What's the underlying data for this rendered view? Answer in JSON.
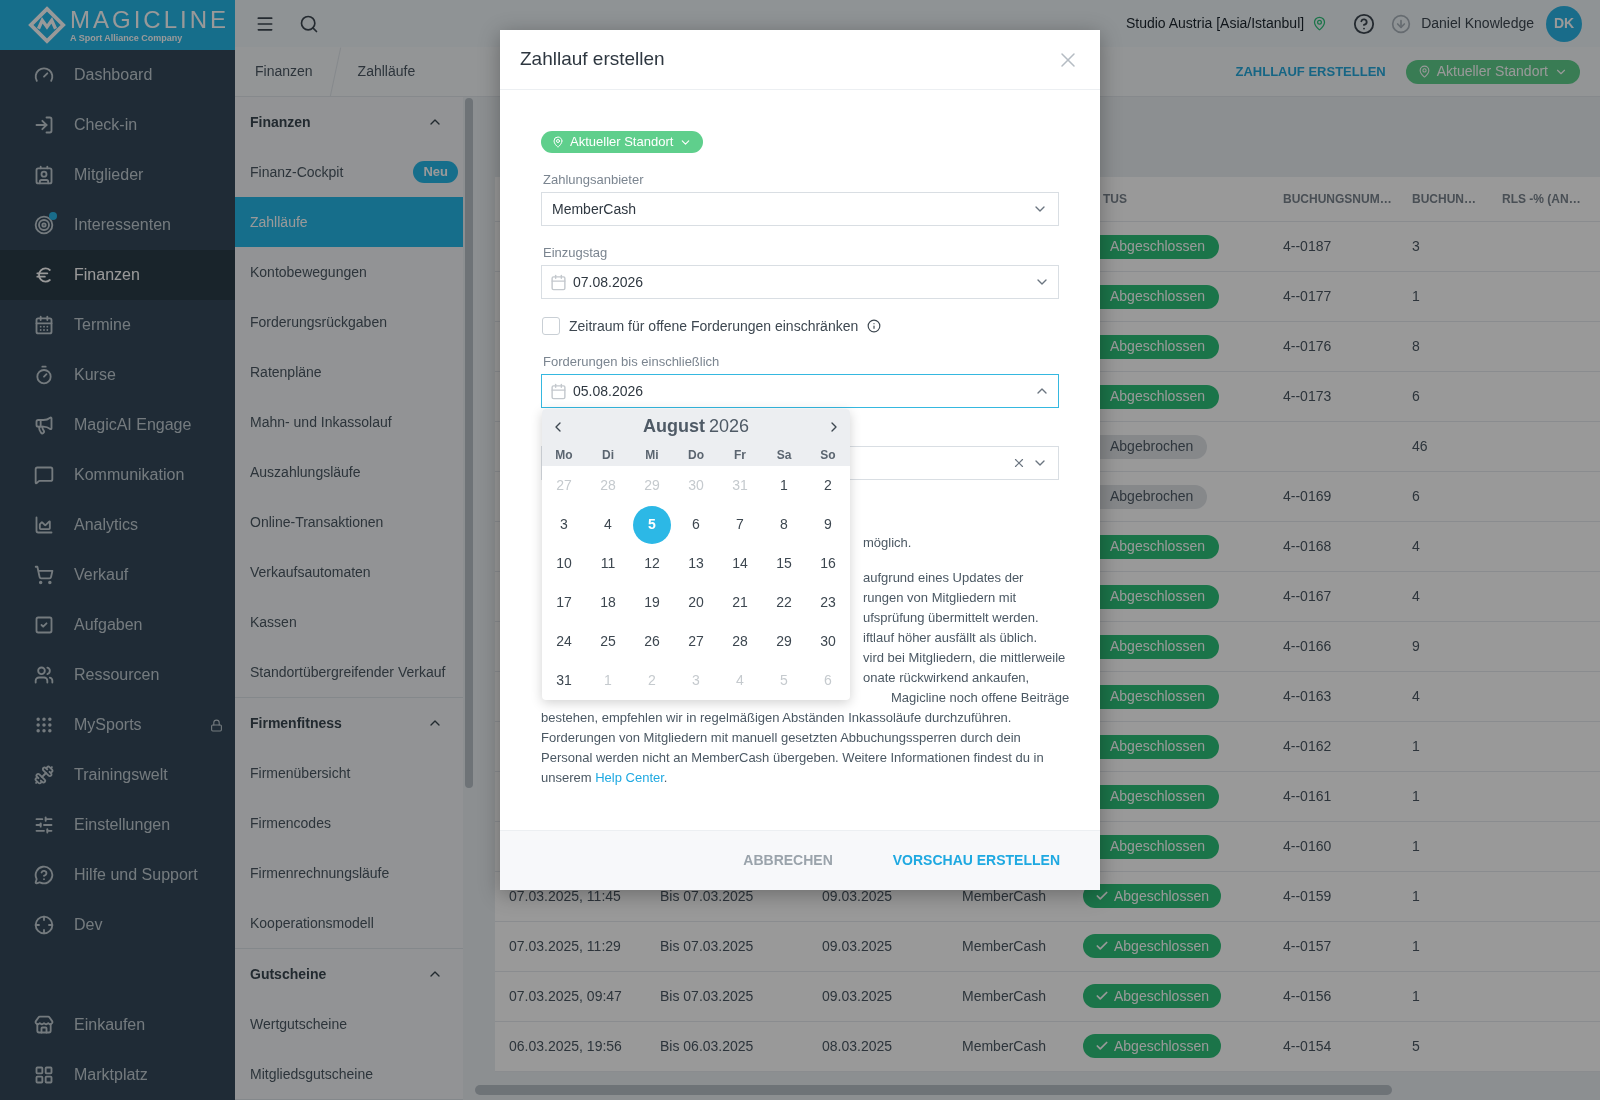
{
  "logo": {
    "name": "MAGICLINE",
    "tagline": "A Sport Alliance Company"
  },
  "nav": [
    {
      "label": "Dashboard",
      "selected": false,
      "dot": false,
      "locked": false
    },
    {
      "label": "Check-in",
      "selected": false,
      "dot": false,
      "locked": false
    },
    {
      "label": "Mitglieder",
      "selected": false,
      "dot": false,
      "locked": false
    },
    {
      "label": "Interessenten",
      "selected": false,
      "dot": true,
      "locked": false
    },
    {
      "label": "Finanzen",
      "selected": true,
      "dot": false,
      "locked": false
    },
    {
      "label": "Termine",
      "selected": false,
      "dot": false,
      "locked": false
    },
    {
      "label": "Kurse",
      "selected": false,
      "dot": false,
      "locked": false
    },
    {
      "label": "MagicAI Engage",
      "selected": false,
      "dot": false,
      "locked": false
    },
    {
      "label": "Kommunikation",
      "selected": false,
      "dot": false,
      "locked": false
    },
    {
      "label": "Analytics",
      "selected": false,
      "dot": false,
      "locked": false
    },
    {
      "label": "Verkauf",
      "selected": false,
      "dot": false,
      "locked": false
    },
    {
      "label": "Aufgaben",
      "selected": false,
      "dot": false,
      "locked": false
    },
    {
      "label": "Ressourcen",
      "selected": false,
      "dot": false,
      "locked": false
    },
    {
      "label": "MySports",
      "selected": false,
      "dot": false,
      "locked": true
    },
    {
      "label": "Trainingswelt",
      "selected": false,
      "dot": false,
      "locked": false
    },
    {
      "label": "Einstellungen",
      "selected": false,
      "dot": false,
      "locked": false
    },
    {
      "label": "Hilfe und Support",
      "selected": false,
      "dot": false,
      "locked": false
    },
    {
      "label": "Dev",
      "selected": false,
      "dot": false,
      "locked": false
    }
  ],
  "nav_bottom": [
    {
      "label": "Einkaufen",
      "selected": false
    },
    {
      "label": "Marktplatz",
      "selected": false
    }
  ],
  "top_bar": {
    "location": "Studio Austria [Asia/Istanbul]",
    "user": "Daniel Knowledge",
    "avatar": "DK"
  },
  "breadcrumb": [
    "Finanzen",
    "Zahlläufe"
  ],
  "header_actions": {
    "link": "ZAHLLAUF ERSTELLEN",
    "location_pill": "Aktueller Standort"
  },
  "subnav": [
    {
      "title": "Finanzen",
      "expanded": true,
      "items": [
        {
          "label": "Finanz-Cockpit",
          "selected": false,
          "badge": "Neu"
        },
        {
          "label": "Zahlläufe",
          "selected": true
        },
        {
          "label": "Kontobewegungen",
          "selected": false
        },
        {
          "label": "Forderungsrückgaben",
          "selected": false
        },
        {
          "label": "Ratenpläne",
          "selected": false
        },
        {
          "label": "Mahn- und Inkassolauf",
          "selected": false
        },
        {
          "label": "Auszahlungsläufe",
          "selected": false
        },
        {
          "label": "Online-Transaktionen",
          "selected": false
        },
        {
          "label": "Verkaufsautomaten",
          "selected": false
        },
        {
          "label": "Kassen",
          "selected": false
        },
        {
          "label": "Standortübergreifender Verkauf",
          "selected": false
        }
      ]
    },
    {
      "title": "Firmenfitness",
      "expanded": true,
      "items": [
        {
          "label": "Firmenübersicht",
          "selected": false
        },
        {
          "label": "Firmencodes",
          "selected": false
        },
        {
          "label": "Firmenrechnungsläufe",
          "selected": false
        },
        {
          "label": "Kooperationsmodell",
          "selected": false
        }
      ]
    },
    {
      "title": "Gutscheine",
      "expanded": true,
      "items": [
        {
          "label": "Wertgutscheine",
          "selected": false
        },
        {
          "label": "Mitgliedsgutscheine",
          "selected": false
        }
      ]
    }
  ],
  "table": {
    "columns": [
      "TUS",
      "BUCHUNGSNUM…",
      "BUCHUN…",
      "RLS -% (AN…"
    ],
    "rows": [
      {
        "status": {
          "kind": "done",
          "label": "Abgeschlossen"
        },
        "column_6": "4--0187",
        "column_7": "3"
      },
      {
        "status": {
          "kind": "done",
          "label": "Abgeschlossen"
        },
        "column_6": "4--0177",
        "column_7": "1"
      },
      {
        "status": {
          "kind": "done",
          "label": "Abgeschlossen"
        },
        "column_6": "4--0176",
        "column_7": "8"
      },
      {
        "status": {
          "kind": "done",
          "label": "Abgeschlossen"
        },
        "column_6": "4--0173",
        "column_7": "6"
      },
      {
        "status": {
          "kind": "cancelled",
          "label": "Abgebrochen"
        },
        "column_7": "46"
      },
      {
        "status": {
          "kind": "cancelled",
          "label": "Abgebrochen"
        },
        "column_6": "4--0169",
        "column_7": "6"
      },
      {
        "status": {
          "kind": "done",
          "label": "Abgeschlossen"
        },
        "column_6": "4--0168",
        "column_7": "4"
      },
      {
        "status": {
          "kind": "done",
          "label": "Abgeschlossen"
        },
        "column_6": "4--0167",
        "column_7": "4"
      },
      {
        "status": {
          "kind": "done",
          "label": "Abgeschlossen"
        },
        "column_6": "4--0166",
        "column_7": "9"
      },
      {
        "status": {
          "kind": "done",
          "label": "Abgeschlossen"
        },
        "column_6": "4--0163",
        "column_7": "4"
      },
      {
        "status": {
          "kind": "done",
          "label": "Abgeschlossen"
        },
        "column_6": "4--0162",
        "column_7": "1"
      },
      {
        "status": {
          "kind": "done",
          "label": "Abgeschlossen"
        },
        "column_6": "4--0161",
        "column_7": "1"
      },
      {
        "status": {
          "kind": "done",
          "label": "Abgeschlossen"
        },
        "column_6": "4--0160",
        "column_7": "1"
      },
      {
        "column_1": "07.03.2025, 11:45",
        "column_2": "Bis 07.03.2025",
        "column_3": "09.03.2025",
        "column_4": "MemberCash",
        "status": {
          "kind": "done",
          "label": "Abgeschlossen"
        },
        "column_6": "4--0159",
        "column_7": "1"
      },
      {
        "column_1": "07.03.2025, 11:29",
        "column_2": "Bis 07.03.2025",
        "column_3": "09.03.2025",
        "column_4": "MemberCash",
        "status": {
          "kind": "done",
          "label": "Abgeschlossen"
        },
        "column_6": "4--0157",
        "column_7": "1"
      },
      {
        "column_1": "07.03.2025, 09:47",
        "column_2": "Bis 07.03.2025",
        "column_3": "09.03.2025",
        "column_4": "MemberCash",
        "status": {
          "kind": "done",
          "label": "Abgeschlossen"
        },
        "column_6": "4--0156",
        "column_7": "1"
      },
      {
        "column_1": "06.03.2025, 19:56",
        "column_2": "Bis 06.03.2025",
        "column_3": "08.03.2025",
        "column_4": "MemberCash",
        "status": {
          "kind": "done",
          "label": "Abgeschlossen"
        },
        "column_6": "4--0154",
        "column_7": "5"
      }
    ]
  },
  "modal": {
    "title": "Zahllauf erstellen",
    "location_pill": "Aktueller Standort",
    "fields": [
      {
        "kind": "select",
        "label": "Zahlungsanbieter",
        "value": "MemberCash"
      },
      {
        "kind": "date",
        "label": "Einzugstag",
        "value": "07.08.2026",
        "focused": false
      },
      {
        "kind": "checkbox",
        "label": "Zeitraum für offene Forderungen einschränken",
        "checked": false
      },
      {
        "kind": "date",
        "label": "Forderungen bis einschließlich",
        "value": "05.08.2026",
        "focused": true
      },
      {
        "kind": "clearable"
      }
    ],
    "calendar": {
      "month": "August",
      "year": "2026",
      "weekdays": [
        "Mo",
        "Di",
        "Mi",
        "Do",
        "Fr",
        "Sa",
        "So"
      ],
      "days": [
        {
          "label": "27",
          "outside": true,
          "selected": false
        },
        {
          "label": "28",
          "outside": true,
          "selected": false
        },
        {
          "label": "29",
          "outside": true,
          "selected": false
        },
        {
          "label": "30",
          "outside": true,
          "selected": false
        },
        {
          "label": "31",
          "outside": true,
          "selected": false
        },
        {
          "label": "1",
          "outside": false,
          "selected": false
        },
        {
          "label": "2",
          "outside": false,
          "selected": false
        },
        {
          "label": "3",
          "outside": false,
          "selected": false
        },
        {
          "label": "4",
          "outside": false,
          "selected": false
        },
        {
          "label": "5",
          "outside": false,
          "selected": true
        },
        {
          "label": "6",
          "outside": false,
          "selected": false
        },
        {
          "label": "7",
          "outside": false,
          "selected": false
        },
        {
          "label": "8",
          "outside": false,
          "selected": false
        },
        {
          "label": "9",
          "outside": false,
          "selected": false
        },
        {
          "label": "10",
          "outside": false,
          "selected": false
        },
        {
          "label": "11",
          "outside": false,
          "selected": false
        },
        {
          "label": "12",
          "outside": false,
          "selected": false
        },
        {
          "label": "13",
          "outside": false,
          "selected": false
        },
        {
          "label": "14",
          "outside": false,
          "selected": false
        },
        {
          "label": "15",
          "outside": false,
          "selected": false
        },
        {
          "label": "16",
          "outside": false,
          "selected": false
        },
        {
          "label": "17",
          "outside": false,
          "selected": false
        },
        {
          "label": "18",
          "outside": false,
          "selected": false
        },
        {
          "label": "19",
          "outside": false,
          "selected": false
        },
        {
          "label": "20",
          "outside": false,
          "selected": false
        },
        {
          "label": "21",
          "outside": false,
          "selected": false
        },
        {
          "label": "22",
          "outside": false,
          "selected": false
        },
        {
          "label": "23",
          "outside": false,
          "selected": false
        },
        {
          "label": "24",
          "outside": false,
          "selected": false
        },
        {
          "label": "25",
          "outside": false,
          "selected": false
        },
        {
          "label": "26",
          "outside": false,
          "selected": false
        },
        {
          "label": "27",
          "outside": false,
          "selected": false
        },
        {
          "label": "28",
          "outside": false,
          "selected": false
        },
        {
          "label": "29",
          "outside": false,
          "selected": false
        },
        {
          "label": "30",
          "outside": false,
          "selected": false
        },
        {
          "label": "31",
          "outside": false,
          "selected": false
        },
        {
          "label": "1",
          "outside": true,
          "selected": false
        },
        {
          "label": "2",
          "outside": true,
          "selected": false
        },
        {
          "label": "3",
          "outside": true,
          "selected": false
        },
        {
          "label": "4",
          "outside": true,
          "selected": false
        },
        {
          "label": "5",
          "outside": true,
          "selected": false
        },
        {
          "label": "6",
          "outside": true,
          "selected": false
        }
      ]
    },
    "note_fragment": "möglich.",
    "paragraph_fragments": [
      "aufgrund eines Updates der",
      "rungen von Mitgliedern mit",
      "ufsprüfung übermittelt werden.",
      "iftlauf höher ausfällt als üblich.",
      "vird bei Mitgliedern, die mittlerweile",
      "onate rückwirkend ankaufen,"
    ],
    "partial_line": "Magicline noch offene Beiträge",
    "paragraph_lines": [
      "bestehen, empfehlen wir in regelmäßigen Abständen Inkassoläufe durchzuführen.",
      "Forderungen von Mitgliedern mit manuell gesetzten Abbuchungssperren durch dein",
      "Personal werden nicht an MemberCash übergeben. Weitere Informationen findest du in"
    ],
    "last_line": {
      "before": "unserem",
      "link": "Help Center",
      "after": "."
    },
    "buttons": [
      {
        "label": "ABBRECHEN",
        "kind": "secondary"
      },
      {
        "label": "VORSCHAU ERSTELLEN",
        "kind": "primary"
      }
    ]
  }
}
